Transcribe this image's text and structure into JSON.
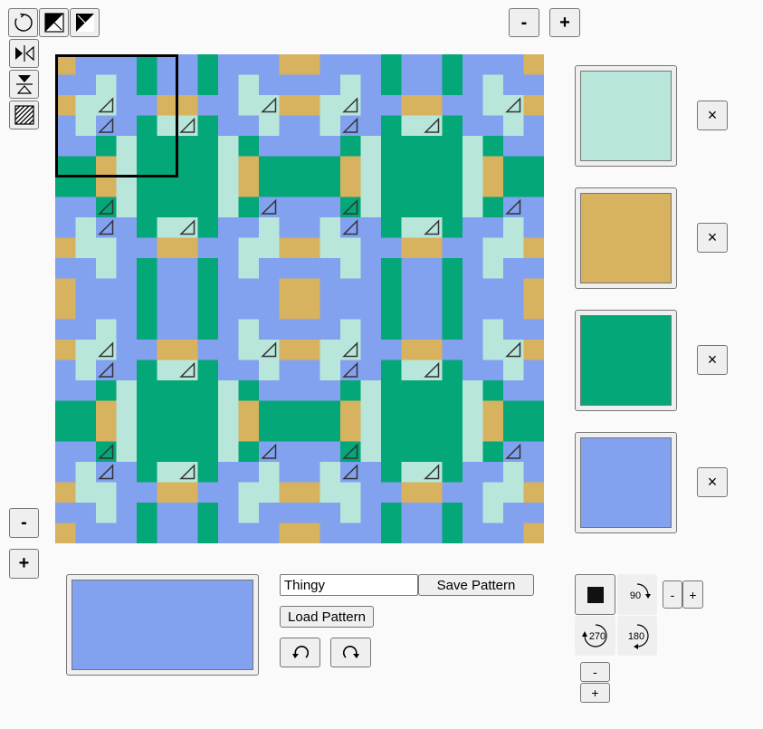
{
  "toolbar": {
    "rotate_icon": "rotate-icon",
    "diag1_icon": "diagonal-split-topleft-icon",
    "diag2_icon": "diagonal-split-bottomleft-icon",
    "mirror_h_icon": "mirror-horizontal-icon",
    "mirror_v_icon": "mirror-vertical-icon",
    "hatch_icon": "hatch-fill-icon"
  },
  "zoom": {
    "minus_label": "-",
    "plus_label": "+"
  },
  "palette": {
    "colors": [
      "#b9e6da",
      "#d7b25f",
      "#04a777",
      "#82a1ef"
    ],
    "remove_label": "×"
  },
  "current_color": "#82a1ef",
  "pattern": {
    "name_value": "Thingy",
    "save_label": "Save Pattern",
    "load_label": "Load Pattern"
  },
  "history": {
    "undo_icon": "undo-icon",
    "redo_icon": "redo-icon"
  },
  "rotation": {
    "options": [
      "90",
      "270",
      "180"
    ],
    "minus_label": "-",
    "plus_label": "+"
  },
  "grid": {
    "cells": [
      [
        "Y",
        "S",
        "S",
        "S",
        "G",
        "S"
      ],
      [
        "S",
        "S",
        "L",
        "S",
        "G",
        "S"
      ],
      [
        "Y",
        "L",
        "L",
        "S",
        "S",
        "Y"
      ],
      [
        "S",
        "L",
        "S",
        "S",
        "G",
        "L"
      ],
      [
        "S",
        "S",
        "G",
        "L",
        "G",
        "G"
      ],
      [
        "G",
        "G",
        "Y",
        "L",
        "G",
        "G"
      ]
    ]
  }
}
